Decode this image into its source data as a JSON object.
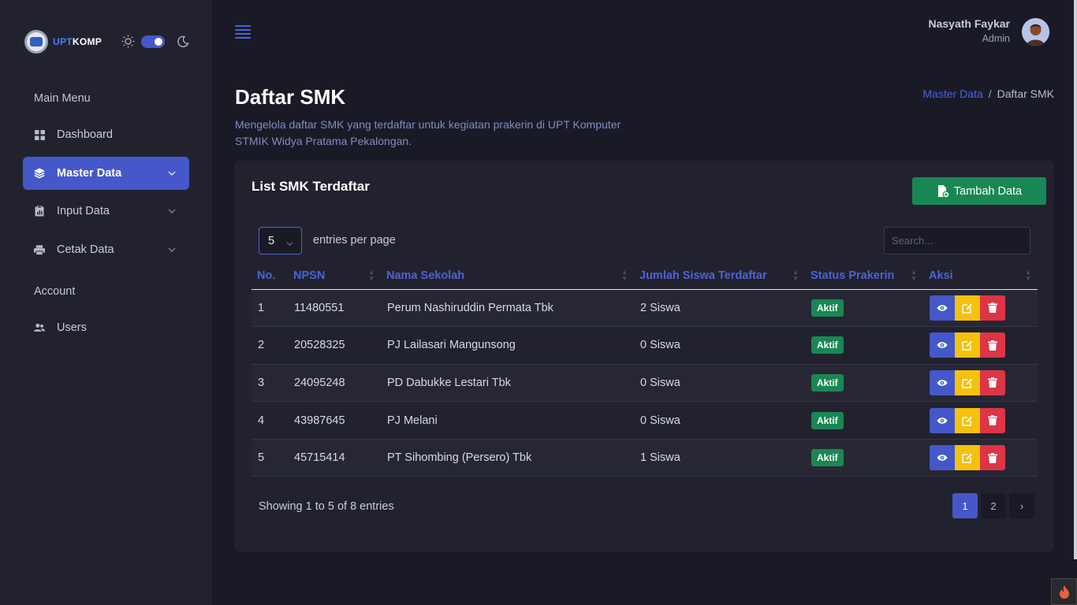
{
  "brand": {
    "part1": "UPT",
    "part2": "KOMP"
  },
  "sidebar": {
    "heading_main": "Main Menu",
    "heading_account": "Account",
    "items": [
      {
        "label": "Dashboard",
        "icon": "grid-icon"
      },
      {
        "label": "Master Data",
        "icon": "layers-icon"
      },
      {
        "label": "Input Data",
        "icon": "clipboard-icon"
      },
      {
        "label": "Cetak Data",
        "icon": "printer-icon"
      },
      {
        "label": "Users",
        "icon": "users-icon"
      }
    ]
  },
  "user": {
    "name": "Nasyath Faykar",
    "role": "Admin"
  },
  "page": {
    "title": "Daftar SMK",
    "description": "Mengelola daftar SMK yang terdaftar untuk kegiatan prakerin di UPT Komputer STMIK Widya Pratama Pekalongan."
  },
  "breadcrumb": {
    "parent": "Master Data",
    "separator": "/",
    "current": "Daftar SMK"
  },
  "card": {
    "title": "List SMK Terdaftar",
    "add_button": "Tambah Data",
    "per_page_value": "5",
    "per_page_label": "entries per page",
    "search_placeholder": "Search..."
  },
  "table": {
    "headers": [
      "No.",
      "NPSN",
      "Nama Sekolah",
      "Jumlah Siswa Terdaftar",
      "Status Prakerin",
      "Aksi"
    ],
    "rows": [
      {
        "no": "1",
        "npsn": "11480551",
        "nama": "Perum Nashiruddin Permata Tbk",
        "jumlah": "2 Siswa",
        "status": "Aktif"
      },
      {
        "no": "2",
        "npsn": "20528325",
        "nama": "PJ Lailasari Mangunsong",
        "jumlah": "0 Siswa",
        "status": "Aktif"
      },
      {
        "no": "3",
        "npsn": "24095248",
        "nama": "PD Dabukke Lestari Tbk",
        "jumlah": "0 Siswa",
        "status": "Aktif"
      },
      {
        "no": "4",
        "npsn": "43987645",
        "nama": "PJ Melani",
        "jumlah": "0 Siswa",
        "status": "Aktif"
      },
      {
        "no": "5",
        "npsn": "45715414",
        "nama": "PT Sihombing (Persero) Tbk",
        "jumlah": "1 Siswa",
        "status": "Aktif"
      }
    ]
  },
  "footer": {
    "showing": "Showing 1 to 5 of 8 entries",
    "pages": [
      "1",
      "2",
      "›"
    ]
  },
  "colors": {
    "accent": "#4458c9",
    "success": "#198754",
    "warning": "#f5c10f",
    "danger": "#dc3545",
    "background": "#1a1a27",
    "panel": "#22222f"
  }
}
